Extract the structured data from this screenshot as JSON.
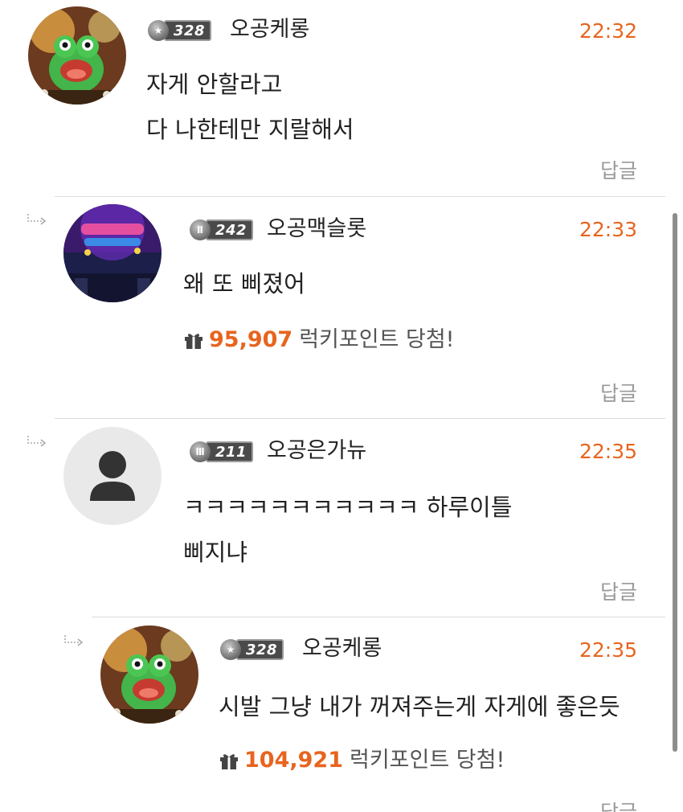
{
  "comments": [
    {
      "level": "328",
      "nickname": "오공케롱",
      "time": "22:32",
      "lines": [
        "자게 안할라고",
        "다 나한테만  지랄해서"
      ],
      "reply_label": "답글"
    },
    {
      "level": "242",
      "nickname": "오공맥슬롯",
      "time": "22:33",
      "lines": [
        "왜 또 삐졌어"
      ],
      "lucky_points": "95,907",
      "lucky_text": "럭키포인트 당첨!",
      "reply_label": "답글"
    },
    {
      "level": "211",
      "nickname": "오공은가뉴",
      "time": "22:35",
      "lines": [
        "ㅋㅋㅋㅋㅋㅋㅋㅋㅋㅋㅋ 하루이틀",
        "삐지냐"
      ],
      "reply_label": "답글"
    },
    {
      "level": "328",
      "nickname": "오공케롱",
      "time": "22:35",
      "lines": [
        "시발 그냥 내가 꺼져주는게 자게에 좋은듯"
      ],
      "lucky_points": "104,921",
      "lucky_text": "럭키포인트 당첨!",
      "reply_label": "답글"
    }
  ],
  "colors": {
    "accent": "#e8641e",
    "reply_text": "#999999",
    "divider": "#dcdcdc"
  },
  "icons": {
    "gift": "gift-icon",
    "reply_arrow": "reply-arrow-icon",
    "default_avatar": "user-silhouette-icon"
  }
}
